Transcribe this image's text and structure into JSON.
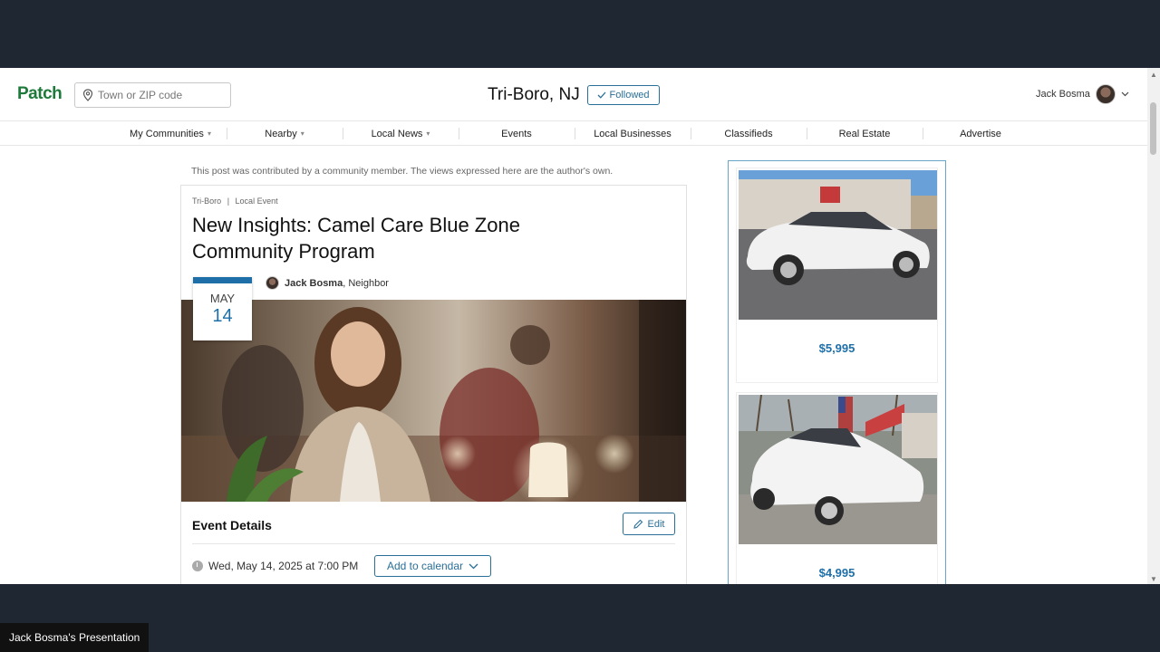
{
  "header": {
    "logo": "Patch",
    "search_placeholder": "Town or ZIP code",
    "community": "Tri-Boro, NJ",
    "followed_label": "Followed",
    "user_name": "Jack Bosma"
  },
  "nav": {
    "items": [
      {
        "label": "My Communities",
        "caret": "▾"
      },
      {
        "label": "Nearby",
        "caret": "▾"
      },
      {
        "label": "Local News",
        "caret": "▾"
      },
      {
        "label": "Events",
        "caret": ""
      },
      {
        "label": "Local Businesses",
        "caret": ""
      },
      {
        "label": "Classifieds",
        "caret": ""
      },
      {
        "label": "Real Estate",
        "caret": ""
      },
      {
        "label": "Advertise",
        "caret": ""
      }
    ]
  },
  "disclaimer": "This post was contributed by a community member. The views expressed here are the author's own.",
  "article": {
    "meta_location": "Tri-Boro",
    "meta_sep": "|",
    "meta_category": "Local Event",
    "title": "New Insights: Camel Care Blue Zone Community Program",
    "date_month": "MAY",
    "date_day": "14",
    "author_name": "Jack Bosma",
    "author_role": ", Neighbor",
    "details_title": "Event Details",
    "edit_label": "Edit",
    "when": "Wed, May 14, 2025 at 7:00 PM",
    "add_calendar_label": "Add to calendar"
  },
  "ads": {
    "listings": [
      {
        "price": "$5,995"
      },
      {
        "price": "$4,995"
      }
    ]
  },
  "presenter_label": "Jack Bosma's Presentation",
  "colors": {
    "brand": "#1d7a3a",
    "accent": "#1e6fa8",
    "frame": "#1f2832"
  }
}
